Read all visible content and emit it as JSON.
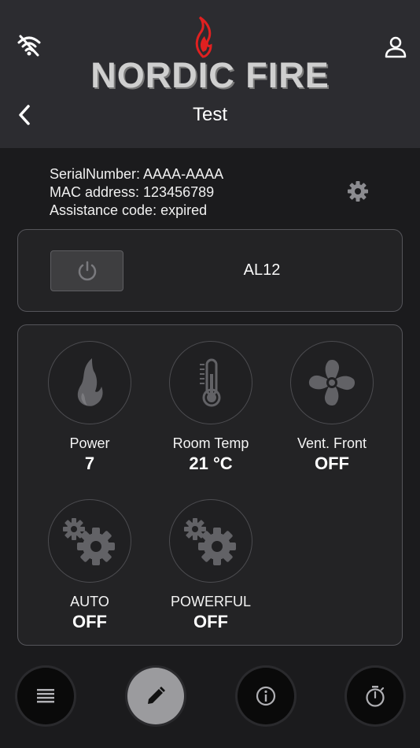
{
  "header": {
    "brand": "NORDIC FIRE",
    "device_name": "Test",
    "icons": {
      "wifi": "wifi-off-icon",
      "user": "user-icon",
      "back": "chevron-left-icon",
      "flame": "flame-logo-icon"
    },
    "colors": {
      "brand_red": "#e02020",
      "brand_text": "#cfcfcf"
    }
  },
  "device_info": {
    "serial": "SerialNumber: AAAA-AAAA",
    "mac": "MAC address: 123456789",
    "assistance": "Assistance code: expired"
  },
  "power_panel": {
    "model": "AL12",
    "power_icon": "power-icon"
  },
  "controls": [
    {
      "label": "Power",
      "value": "7",
      "icon": "flame-icon"
    },
    {
      "label": "Room Temp",
      "value": "21 °C",
      "icon": "thermometer-icon"
    },
    {
      "label": "Vent. Front",
      "value": "OFF",
      "icon": "fan-icon"
    },
    {
      "label": "AUTO",
      "value": "OFF",
      "icon": "gears-icon"
    },
    {
      "label": "POWERFUL",
      "value": "OFF",
      "icon": "gears-icon"
    }
  ],
  "bottom_nav": [
    {
      "icon": "list-icon",
      "active": false
    },
    {
      "icon": "edit-icon",
      "active": true
    },
    {
      "icon": "info-icon",
      "active": false
    },
    {
      "icon": "timer-icon",
      "active": false
    }
  ]
}
